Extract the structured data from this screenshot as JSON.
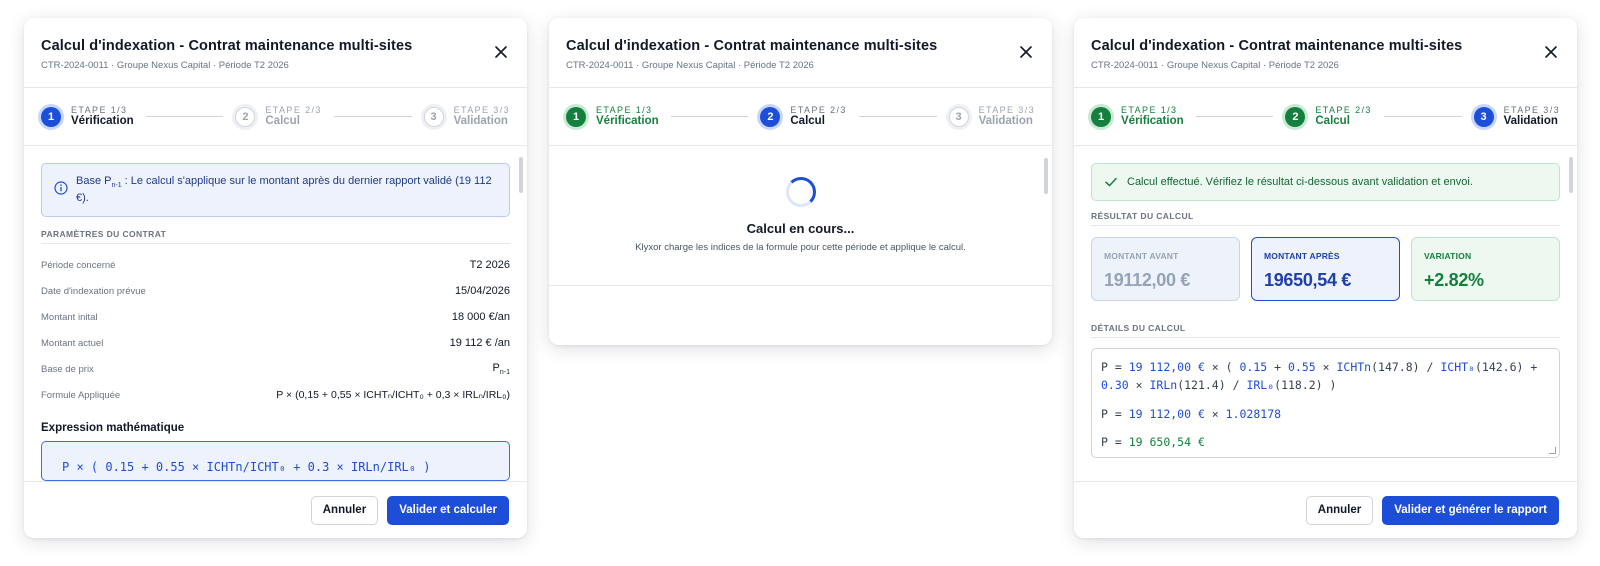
{
  "modals": [
    {
      "title": "Calcul d'indexation - Contrat maintenance multi-sites",
      "subtitle": "CTR-2024-0011 · Groupe Nexus Capital · Période T2 2026",
      "steps": [
        {
          "num": "1",
          "kicker": "ETAPE 1/3",
          "name": "Vérification",
          "state": "active"
        },
        {
          "num": "2",
          "kicker": "ETAPE 2/3",
          "name": "Calcul",
          "state": "todo"
        },
        {
          "num": "3",
          "kicker": "ETAPE 3/3",
          "name": "Validation",
          "state": "todo"
        }
      ]
    },
    {
      "title": "Calcul d'indexation - Contrat maintenance multi-sites",
      "subtitle": "CTR-2024-0011 · Groupe Nexus Capital · Période T2 2026",
      "steps": [
        {
          "num": "1",
          "kicker": "ETAPE 1/3",
          "name": "Vérification",
          "state": "done"
        },
        {
          "num": "2",
          "kicker": "ETAPE 2/3",
          "name": "Calcul",
          "state": "active"
        },
        {
          "num": "3",
          "kicker": "ETAPE 3/3",
          "name": "Validation",
          "state": "todo"
        }
      ]
    },
    {
      "title": "Calcul d'indexation - Contrat maintenance multi-sites",
      "subtitle": "CTR-2024-0011 · Groupe Nexus Capital · Période T2 2026",
      "steps": [
        {
          "num": "1",
          "kicker": "ETAPE 1/3",
          "name": "Vérification",
          "state": "done"
        },
        {
          "num": "2",
          "kicker": "ETAPE 2/3",
          "name": "Calcul",
          "state": "done"
        },
        {
          "num": "3",
          "kicker": "ETAPE 3/3",
          "name": "Validation",
          "state": "active"
        }
      ]
    }
  ],
  "verification": {
    "info_prefix": "Base P",
    "info_sub": "n-1",
    "info_text": " : Le calcul s'applique sur le montant après du dernier rapport validé (19 112 €).",
    "section_title": "PARAMÈTRES DU CONTRAT",
    "params": [
      {
        "label": "Période concerné",
        "value": "T2 2026"
      },
      {
        "label": "Date d'indexation prévue",
        "value": "15/04/2026"
      },
      {
        "label": "Montant inital",
        "value": "18 000 €/an"
      },
      {
        "label": "Montant actuel",
        "value": "19 112 € /an"
      }
    ],
    "base_label": "Base de prix",
    "base_value": "P",
    "base_sub": "n-1",
    "formula_label": "Formule Appliquée",
    "formula_value": "P × (0,15 + 0,55 × ICHTₙ/ICHT₀ + 0,3 × IRLₙ/IRL₀)",
    "expr_title": "Expression mathématique",
    "expr_text": "P × ( 0.15 + 0.55 × ICHTn/ICHT₀ + 0.3 × IRLn/IRL₀ )",
    "cancel": "Annuler",
    "submit": "Valider et calculer"
  },
  "loading": {
    "title": "Calcul en cours...",
    "subtitle": "Klyxor charge les indices de la formule pour cette période et applique le calcul."
  },
  "validation": {
    "success": "Calcul effectué. Vérifiez le résultat ci-dessous avant validation et envoi.",
    "result_title": "RÉSULTAT DU CALCUL",
    "cards": [
      {
        "label": "MONTANT AVANT",
        "value": "19112,00 €"
      },
      {
        "label": "MONTANT APRÈS",
        "value": "19650,54 €"
      },
      {
        "label": "VARIATION",
        "value": "+2.82%"
      }
    ],
    "details_title": "DÉTAILS DU CALCUL",
    "code": {
      "l1": {
        "p": "P = ",
        "amount": "19 112,00 €",
        "t1": " × ( ",
        "c1": "0.15",
        "t2": " + ",
        "c2": "0.55",
        "t3": " × ",
        "ichtn": "ICHTn",
        "v1": "(147.8) / ",
        "icht0": "ICHT₀",
        "v2": "(142.6) +"
      },
      "l2": {
        "c3": "0.30",
        "t4": " × ",
        "irln": "IRLn",
        "v3": "(121.4) / ",
        "irl0": "IRL₀",
        "v4": "(118.2) )"
      },
      "l3": {
        "p": "P = ",
        "amount": "19 112,00 €",
        "t": " × ",
        "factor": "1.028178"
      },
      "l4": {
        "p": "P = ",
        "amount": "19 650,54 €"
      }
    },
    "cancel": "Annuler",
    "submit": "Valider et générer le rapport"
  }
}
